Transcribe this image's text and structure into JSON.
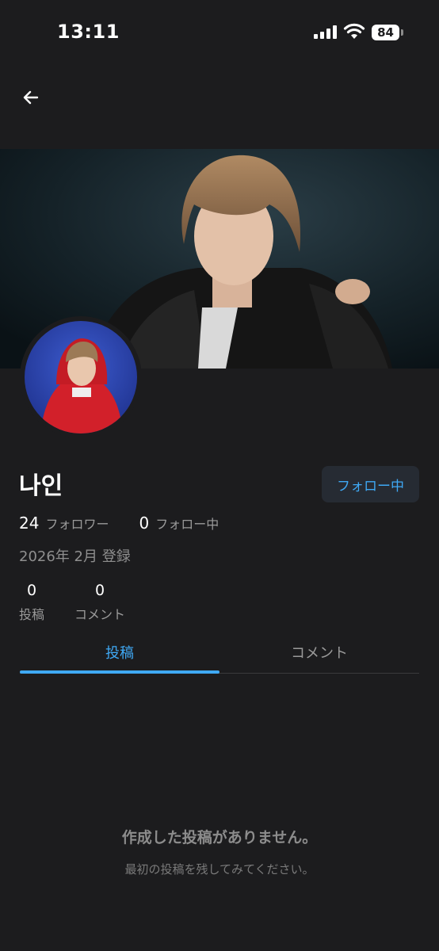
{
  "status_bar": {
    "time": "13:11",
    "battery": "84",
    "icons": [
      "signal-icon",
      "wifi-icon",
      "battery-icon"
    ]
  },
  "header": {
    "back_icon": "arrow-left-icon"
  },
  "profile": {
    "name": "나인",
    "follow_button": "フォロー中",
    "followers_count": "24",
    "followers_label": "フォロワー",
    "following_count": "0",
    "following_label": "フォロー中",
    "joined": "2026年 2月 登録"
  },
  "counts": [
    {
      "value": "0",
      "label": "投稿"
    },
    {
      "value": "0",
      "label": "コメント"
    }
  ],
  "tabs": [
    {
      "label": "投稿",
      "active": true
    },
    {
      "label": "コメント",
      "active": false
    }
  ],
  "empty_state": {
    "title": "作成した投稿がありません。",
    "subtitle": "最初の投稿を残してみてください。"
  },
  "colors": {
    "background": "#1c1c1e",
    "accent": "#3fa9f5",
    "muted_text": "#9a9a9a",
    "button_bg": "#262b33"
  }
}
